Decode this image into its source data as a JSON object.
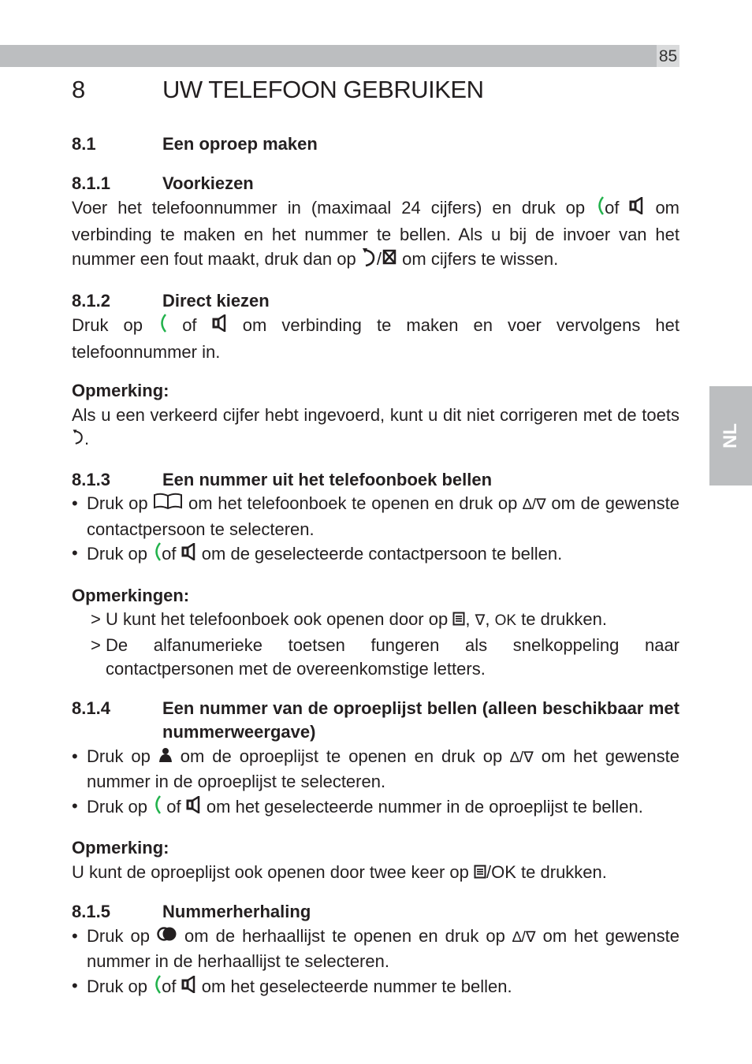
{
  "page_number": "85",
  "language_tab": "NL",
  "chapter": {
    "number": "8",
    "title": "UW TELEFOON GEBRUIKEN"
  },
  "section_8_1": {
    "number": "8.1",
    "title": "Een oproep maken"
  },
  "s811": {
    "number": "8.1.1",
    "title": "Voorkiezen",
    "t1": "Voer het telefoonnummer in (maximaal 24 cijfers) en druk op",
    "t2": "of",
    "t3": "om verbinding te maken en het nummer te bellen. Als u bij de invoer van het nummer een fout maakt, druk dan op",
    "slash": "/",
    "t4": "om cijfers te wissen."
  },
  "s812": {
    "number": "8.1.2",
    "title": "Direct kiezen",
    "t1": "Druk op",
    "t2": "of",
    "t3": "om verbinding te maken en voer vervolgens het telefoonnummer in.",
    "note_title": "Opmerking:",
    "note_t1": "Als u een verkeerd cijfer hebt ingevoerd, kunt u dit niet corrigeren met de toets",
    "note_t2": "."
  },
  "s813": {
    "number": "8.1.3",
    "title": "Een nummer uit het telefoonboek bellen",
    "b1_t1": "Druk op",
    "b1_t2": "om het telefoonboek te openen en druk op",
    "b1_t3": "om de gewenste contactpersoon te selecteren.",
    "b2_t1": "Druk op",
    "b2_t2": "of",
    "b2_t3": "om de geselecteerde contactpersoon te bellen.",
    "notes_title": "Opmerkingen:",
    "n1_t1": "U kunt het telefoonboek ook openen door op",
    "n1_sep": ",",
    "n1_ok": "OK",
    "n1_t2": "te drukken.",
    "n2": "De alfanumerieke toetsen fungeren als snelkoppeling naar contactpersonen met de overeenkomstige letters."
  },
  "s814": {
    "number": "8.1.4",
    "title": "Een nummer van de oproeplijst bellen (alleen beschikbaar met nummerweergave)",
    "b1_t1": "Druk op",
    "b1_t2": "om de oproeplijst te openen en druk op",
    "b1_t3": "om het gewenste nummer in de oproeplijst te selecteren.",
    "b2_t1": "Druk op",
    "b2_t2": "of",
    "b2_t3": "om het geselecteerde nummer in de oproeplijst te bellen.",
    "note_title": "Opmerking:",
    "note_t1": "U kunt de oproeplijst ook openen door twee keer op",
    "note_ok": "/OK",
    "note_t2": "te drukken."
  },
  "s815": {
    "number": "8.1.5",
    "title": "Nummerherhaling",
    "b1_t1": "Druk op",
    "b1_t2": "om de herhaallijst te openen en druk op",
    "b1_t3": "om het gewenste nummer in de herhaallijst te selecteren.",
    "b2_t1": "Druk op",
    "b2_t2": "of",
    "b2_t3": "om het geselecteerde nummer te bellen."
  },
  "symbols": {
    "bullet": "•",
    "arrow": ">",
    "updown": "∆/∇",
    "down": "∇"
  },
  "colors": {
    "accent_green": "#22b24c",
    "bar_gray": "#bcbec0"
  }
}
